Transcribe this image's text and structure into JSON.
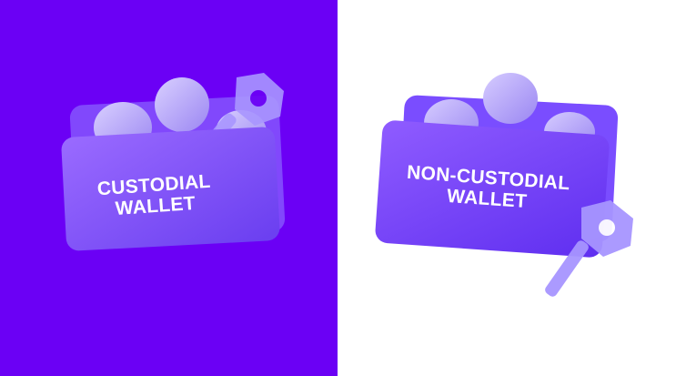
{
  "left_panel": {
    "label_line1": "CUSTODIAL",
    "label_line2": "WALLET",
    "background": "#6b00f5"
  },
  "right_panel": {
    "label_line1": "NON-CUSTODIAL",
    "label_line2": "WALLET",
    "background": "#ffffff"
  }
}
